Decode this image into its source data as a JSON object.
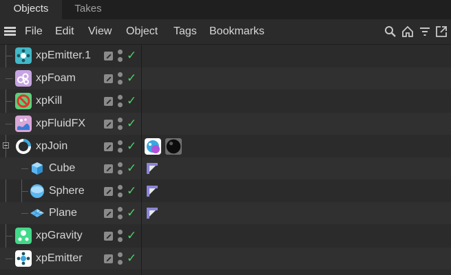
{
  "tabs": [
    {
      "label": "Objects",
      "active": true
    },
    {
      "label": "Takes",
      "active": false
    }
  ],
  "menu": [
    "File",
    "Edit",
    "View",
    "Object",
    "Tags",
    "Bookmarks"
  ],
  "toolbar_icons": [
    "search-icon",
    "home-icon",
    "filter-icon",
    "new-window-icon"
  ],
  "objects": [
    {
      "name": "xpEmitter.1",
      "icon": "emitter-icon",
      "indent": 0,
      "tags": []
    },
    {
      "name": "xpFoam",
      "icon": "foam-icon",
      "indent": 0,
      "tags": []
    },
    {
      "name": "xpKill",
      "icon": "kill-icon",
      "indent": 0,
      "tags": []
    },
    {
      "name": "xpFluidFX",
      "icon": "fluidfx-icon",
      "indent": 0,
      "tags": []
    },
    {
      "name": "xpJoin",
      "icon": "join-icon",
      "indent": 0,
      "expanded": true,
      "tags": [
        "xp-tag-icon",
        "material-tag-icon"
      ]
    },
    {
      "name": "Cube",
      "icon": "cube-icon",
      "indent": 1,
      "tags": [
        "phong-tag-icon"
      ]
    },
    {
      "name": "Sphere",
      "icon": "sphere-icon",
      "indent": 1,
      "tags": [
        "phong-tag-icon"
      ]
    },
    {
      "name": "Plane",
      "icon": "plane-icon",
      "indent": 1,
      "tags": [
        "phong-tag-icon"
      ]
    },
    {
      "name": "xpGravity",
      "icon": "gravity-icon",
      "indent": 0,
      "tags": []
    },
    {
      "name": "xpEmitter",
      "icon": "emitter-icon",
      "indent": 0,
      "tags": []
    }
  ],
  "colors": {
    "background": "#2b2b2b",
    "tab_background": "#1f1f1f",
    "check_green": "#4fd06a",
    "phong_tag": "#8b86d8"
  }
}
